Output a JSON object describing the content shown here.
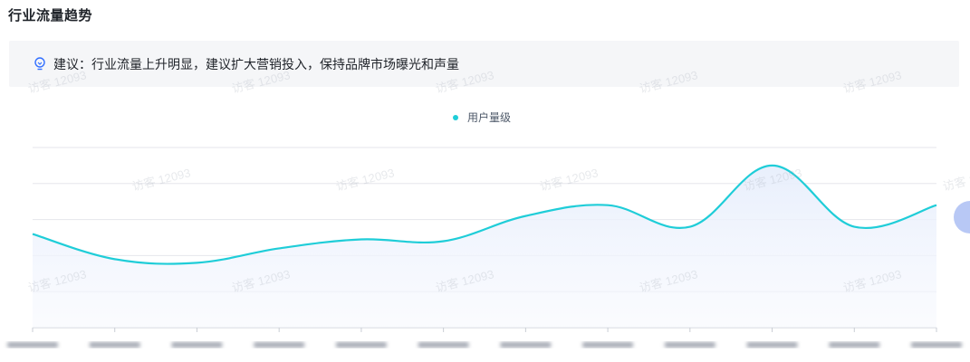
{
  "page": {
    "title": "行业流量趋势"
  },
  "tip": {
    "label": "建议：",
    "text": "行业流量上升明显，建议扩大营销投入，保持品牌市场曝光和声量",
    "icon": "lightbulb-icon"
  },
  "watermark": "访客 12093",
  "chart_data": {
    "type": "area",
    "title": "",
    "xlabel": "",
    "ylabel": "",
    "x": [
      "",
      "",
      "",
      "",
      "",
      "",
      "",
      "",
      "",
      "",
      "",
      ""
    ],
    "series": [
      {
        "name": "用户量级",
        "values": [
          2.6,
          1.9,
          1.8,
          2.2,
          2.45,
          2.4,
          3.1,
          3.4,
          2.8,
          4.5,
          2.8,
          3.4
        ]
      }
    ],
    "ylim": [
      0,
      5
    ],
    "grid": true,
    "legend_position": "top-center",
    "colors": {
      "line": "#1fcdd8",
      "area_top": "#e7eefc",
      "area_bottom": "#f7f9fe",
      "grid": "#e5e6eb"
    }
  }
}
